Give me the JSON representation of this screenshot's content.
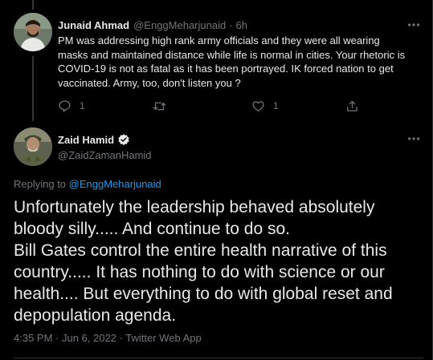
{
  "colors": {
    "background": "#000000",
    "text_primary": "#e7e9ea",
    "text_secondary": "#71767b",
    "link_blue": "#1d9bf0",
    "divider": "#2f3336",
    "thread_line": "#333639"
  },
  "reply_tweet": {
    "author_name": "Junaid Ahmad",
    "author_handle": "@EnggMeharjunaid",
    "separator": "·",
    "time_ago": "6h",
    "body": "PM was addressing high rank army officials and they were all wearing\nmasks and maintained distance while life is normal in cities. Your rhetoric is\nCOVID-19 is not as fatal as it has been portrayed. IK forced nation to get\nvaccinated. Army, too, don't listen you ?",
    "reply_count": "1",
    "retweet_count": "",
    "like_count": "1",
    "icons": {
      "reply": "reply-icon",
      "retweet": "retweet-icon",
      "like": "heart-icon",
      "share": "share-icon",
      "more": "more-horizontal-icon"
    }
  },
  "main_tweet": {
    "author_name": "Zaid Hamid",
    "author_handle": "@ZaidZamanHamid",
    "verified_icon": "verified-badge-icon",
    "replying_label": "Replying to",
    "replying_handle": "@EnggMeharjunaid",
    "body": "Unfortunately the leadership behaved absolutely\nbloody silly..... And continue to do so.\nBill Gates control the entire health narrative of this\ncountry..... It has nothing to do with science or our\nhealth.... But everything to do with global reset and\ndepopulation agenda.",
    "timestamp": "4:35 PM · Jun 6, 2022",
    "separator": "·",
    "source": "Twitter Web App"
  }
}
